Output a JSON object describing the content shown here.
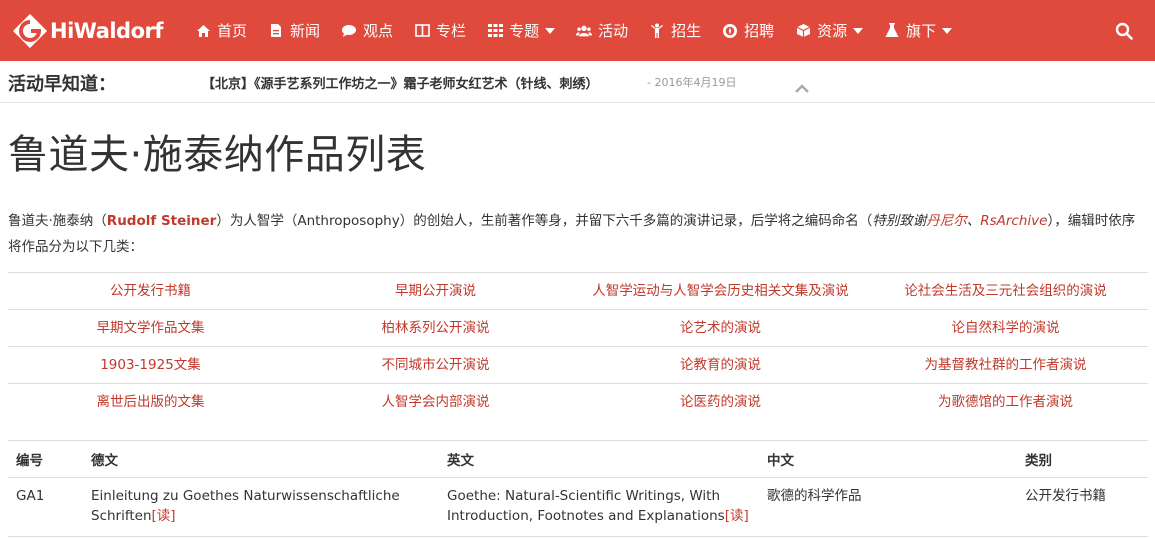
{
  "brand": {
    "name": "HiWaldorf",
    "color": "#e04a3c"
  },
  "nav": {
    "items": [
      {
        "label": "首页",
        "icon": "home-icon"
      },
      {
        "label": "新闻",
        "icon": "document-icon"
      },
      {
        "label": "观点",
        "icon": "comment-icon"
      },
      {
        "label": "专栏",
        "icon": "columns-icon"
      },
      {
        "label": "专题",
        "icon": "grid-icon",
        "dropdown": true
      },
      {
        "label": "活动",
        "icon": "users-icon"
      },
      {
        "label": "招生",
        "icon": "child-icon"
      },
      {
        "label": "招聘",
        "icon": "compass-icon"
      },
      {
        "label": "资源",
        "icon": "cube-icon",
        "dropdown": true
      },
      {
        "label": "旗下",
        "icon": "flask-icon",
        "dropdown": true
      }
    ],
    "search_icon": "search-icon"
  },
  "ticker": {
    "label": "活动早知道：",
    "item": "【北京】《源手艺系列工作坊之一》霜子老师女红艺术（针线、刺绣）",
    "date": "- 2016年4月19日"
  },
  "page": {
    "title": "鲁道夫·施泰纳作品列表"
  },
  "intro": {
    "p1": "鲁道夫·施泰纳（",
    "name_en": "Rudolf Steiner",
    "p2": "）为人智学（Anthroposophy）的创始人，生前著作等身，并留下六千多篇的演讲记录，后学将之编码命名（",
    "thanks": "特别致谢",
    "link1": "丹尼尔",
    "sep": "、",
    "link2": "RsArchive",
    "p3": "），编辑时依序将作品分为以下几类："
  },
  "categories": [
    [
      "公开发行书籍",
      "早期公开演说",
      "人智学运动与人智学会历史相关文集及演说",
      "论社会生活及三元社会组织的演说"
    ],
    [
      "早期文学作品文集",
      "柏林系列公开演说",
      "论艺术的演说",
      "论自然科学的演说"
    ],
    [
      "1903-1925文集",
      "不同城市公开演说",
      "论教育的演说",
      "为基督教社群的工作者演说"
    ],
    [
      "离世后出版的文集",
      "人智学会内部演说",
      "论医药的演说",
      "为歌德馆的工作者演说"
    ]
  ],
  "table": {
    "headers": [
      "编号",
      "德文",
      "英文",
      "中文",
      "类别"
    ],
    "rows": [
      {
        "id": "GA1",
        "de": "Einleitung zu Goethes Naturwissenschaftliche Schriften",
        "de_link": "[读]",
        "en": "Goethe: Natural-Scientific Writings, With Introduction, Footnotes and Explanations",
        "en_link": "[读]",
        "zh": "歌德的科学作品",
        "category": "公开发行书籍"
      }
    ]
  }
}
